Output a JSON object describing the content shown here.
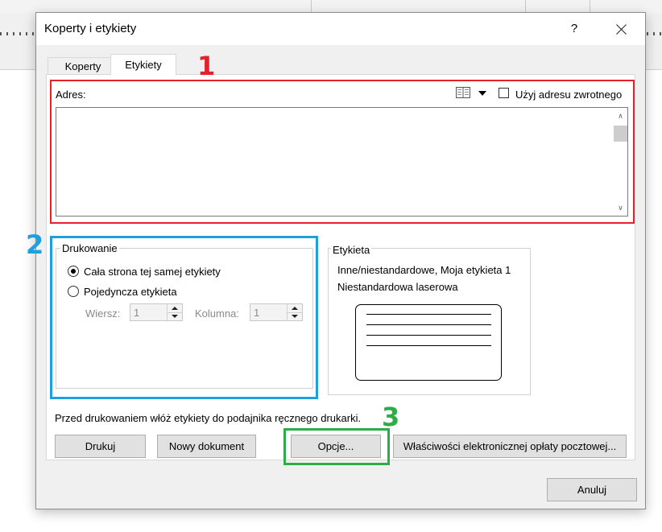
{
  "dialog": {
    "title": "Koperty i etykiety",
    "help": "?"
  },
  "tabs": [
    {
      "label": "Koperty",
      "active": false
    },
    {
      "label": "Etykiety",
      "active": true
    }
  ],
  "address": {
    "label": "Adres:",
    "value": "",
    "return_address_label": "Użyj adresu zwrotnego",
    "return_address_checked": false
  },
  "printing": {
    "title": "Drukowanie",
    "options": [
      {
        "label": "Cała strona tej samej etykiety",
        "checked": true
      },
      {
        "label": "Pojedyncza etykieta",
        "checked": false
      }
    ],
    "row_label": "Wiersz:",
    "row_value": "1",
    "column_label": "Kolumna:",
    "column_value": "1"
  },
  "label_info": {
    "title": "Etykieta",
    "line1": "Inne/niestandardowe, Moja etykieta 1",
    "line2": "Niestandardowa laserowa"
  },
  "hint": "Przed drukowaniem włóż etykiety do podajnika ręcznego drukarki.",
  "buttons": {
    "print": "Drukuj",
    "new_document": "Nowy dokument",
    "options": "Opcje...",
    "postage": "Właściwości elektronicznej opłaty pocztowej...",
    "cancel": "Anuluj"
  },
  "annotations": [
    {
      "number": "1",
      "color": "#e2222d"
    },
    {
      "number": "2",
      "color": "#1e9fe0"
    },
    {
      "number": "3",
      "color": "#2eac48"
    }
  ]
}
